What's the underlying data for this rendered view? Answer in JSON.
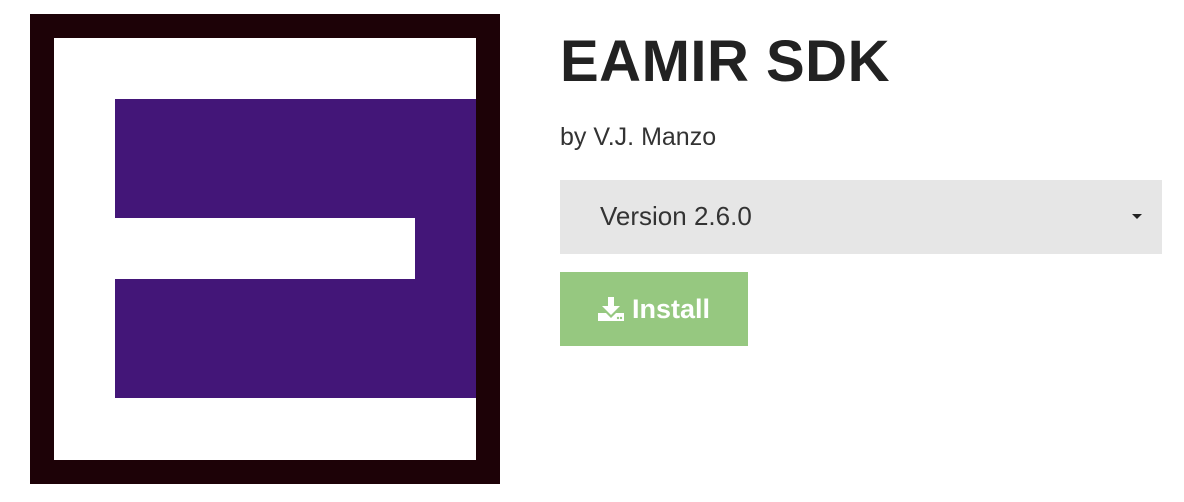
{
  "package": {
    "title": "EAMIR SDK",
    "byline": "by V.J. Manzo"
  },
  "version_select": {
    "selected": "Version 2.6.0"
  },
  "install_button": {
    "label": "Install",
    "icon": "download-icon"
  },
  "colors": {
    "logo_frame": "#1d0207",
    "logo_purple": "#431678",
    "select_bg": "#e6e6e6",
    "install_bg": "#96c880"
  }
}
